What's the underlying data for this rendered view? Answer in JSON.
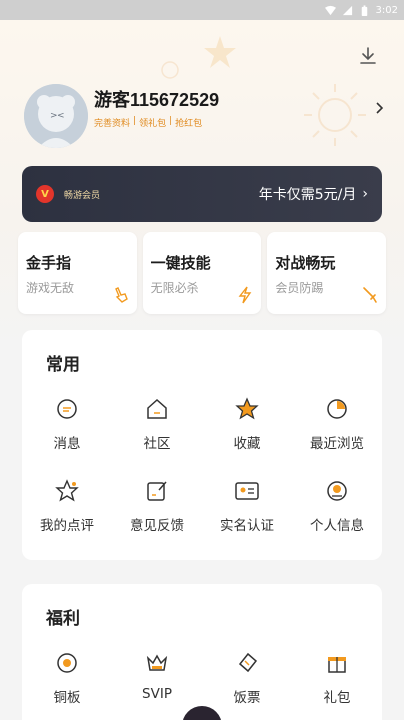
{
  "status_bar": {
    "time": "3:02"
  },
  "profile": {
    "username": "游客115672529",
    "links": [
      "完善资料",
      "领礼包",
      "抢红包"
    ],
    "link_separator": "|"
  },
  "vip": {
    "badge": "V",
    "title": "畅游会员",
    "price": "年卡仅需5元/月",
    "arrow": "›"
  },
  "features": [
    {
      "title": "金手指",
      "subtitle": "游戏无敌"
    },
    {
      "title": "一键技能",
      "subtitle": "无限必杀"
    },
    {
      "title": "对战畅玩",
      "subtitle": "会员防踢"
    }
  ],
  "common": {
    "title": "常用",
    "items": [
      {
        "label": "消息"
      },
      {
        "label": "社区"
      },
      {
        "label": "收藏"
      },
      {
        "label": "最近浏览"
      },
      {
        "label": "我的点评"
      },
      {
        "label": "意见反馈"
      },
      {
        "label": "实名认证"
      },
      {
        "label": "个人信息"
      }
    ]
  },
  "welfare": {
    "title": "福利",
    "items": [
      {
        "label": "铜板"
      },
      {
        "label": "SVIP"
      },
      {
        "label": "饭票"
      },
      {
        "label": "礼包"
      }
    ]
  },
  "colors": {
    "accent": "#f29a1f",
    "vip_bg": "#2d3140",
    "link": "#e08a1e"
  }
}
